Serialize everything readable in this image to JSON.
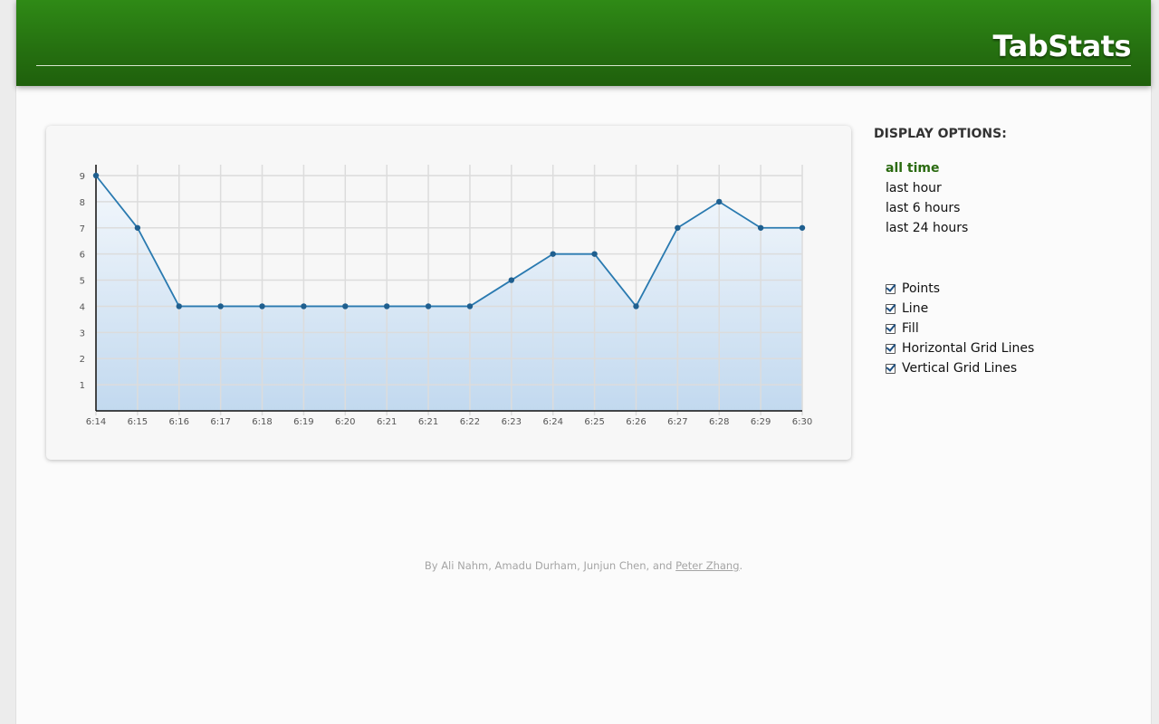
{
  "app": {
    "title": "TabStats"
  },
  "sidebar": {
    "heading": "DISPLAY OPTIONS:",
    "ranges": [
      {
        "label": "all time",
        "active": true
      },
      {
        "label": "last hour",
        "active": false
      },
      {
        "label": "last 6 hours",
        "active": false
      },
      {
        "label": "last 24 hours",
        "active": false
      }
    ],
    "options": [
      {
        "label": "Points",
        "checked": true
      },
      {
        "label": "Line",
        "checked": true
      },
      {
        "label": "Fill",
        "checked": true
      },
      {
        "label": "Horizontal Grid Lines",
        "checked": true
      },
      {
        "label": "Vertical Grid Lines",
        "checked": true
      }
    ]
  },
  "footer": {
    "prefix": "By Ali Nahm, Amadu Durham, Junjun Chen, and ",
    "link": "Peter Zhang",
    "suffix": "."
  },
  "colors": {
    "header_green": "#2f8a16",
    "active_range": "#2a6a10",
    "line": "#2a7ab0",
    "point": "#1f5f8f"
  },
  "chart_data": {
    "type": "area",
    "title": "",
    "xlabel": "",
    "ylabel": "",
    "categories": [
      "6:14",
      "6:15",
      "6:16",
      "6:17",
      "6:18",
      "6:19",
      "6:20",
      "6:21",
      "6:21",
      "6:22",
      "6:23",
      "6:24",
      "6:25",
      "6:26",
      "6:27",
      "6:28",
      "6:29",
      "6:30"
    ],
    "values": [
      9,
      7,
      4,
      4,
      4,
      4,
      4,
      4,
      4,
      4,
      5,
      6,
      6,
      4,
      7,
      8,
      7,
      7
    ],
    "y_ticks": [
      1,
      2,
      3,
      4,
      5,
      6,
      7,
      8,
      9
    ],
    "ylim": [
      0,
      9
    ],
    "grid": {
      "horizontal": true,
      "vertical": true
    },
    "points": true,
    "line": true,
    "fill": true
  }
}
